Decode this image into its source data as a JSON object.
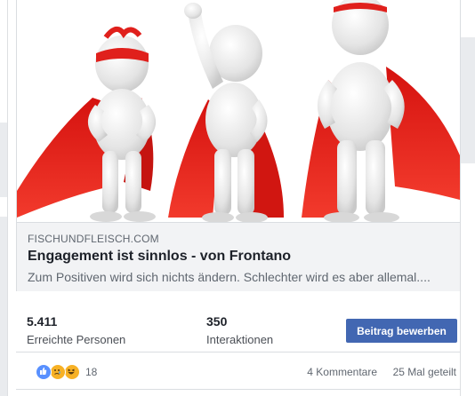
{
  "post": {
    "link": {
      "domain": "FISCHUNDFLEISCH.COM",
      "title": "Engagement ist sinnlos - von Frontano",
      "description": "Zum Positiven wird sich nichts ändern. Schlechter wird es aber allemal....",
      "image_icon": "three-superhero-figures-image"
    },
    "insights": {
      "reach": {
        "value": "5.411",
        "label": "Erreichte Personen"
      },
      "engagements": {
        "value": "350",
        "label": "Interaktionen"
      }
    },
    "promote_button": "Beitrag bewerben",
    "reactions": {
      "icons": [
        "like-icon",
        "sad-icon",
        "haha-icon"
      ],
      "count": "18"
    },
    "comments": "4 Kommentare",
    "shares": "25 Mal geteilt"
  },
  "colors": {
    "brand_blue": "#4267b2",
    "cape_red": "#e0201c",
    "figure_gray": "#e6e6e6"
  }
}
